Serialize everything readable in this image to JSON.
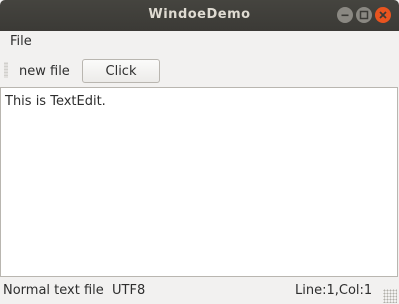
{
  "window": {
    "title": "WindoeDemo"
  },
  "menubar": {
    "items": [
      {
        "label": "File"
      }
    ]
  },
  "toolbar": {
    "new_file_label": "new file",
    "click_label": "Click"
  },
  "editor": {
    "content": "This is TextEdit."
  },
  "statusbar": {
    "left": "Normal text file  UTF8",
    "right": "Line:1,Col:1"
  },
  "colors": {
    "titlebar": "#3d3c38",
    "close_button": "#e9541f",
    "window_bg": "#f2f1f0"
  }
}
